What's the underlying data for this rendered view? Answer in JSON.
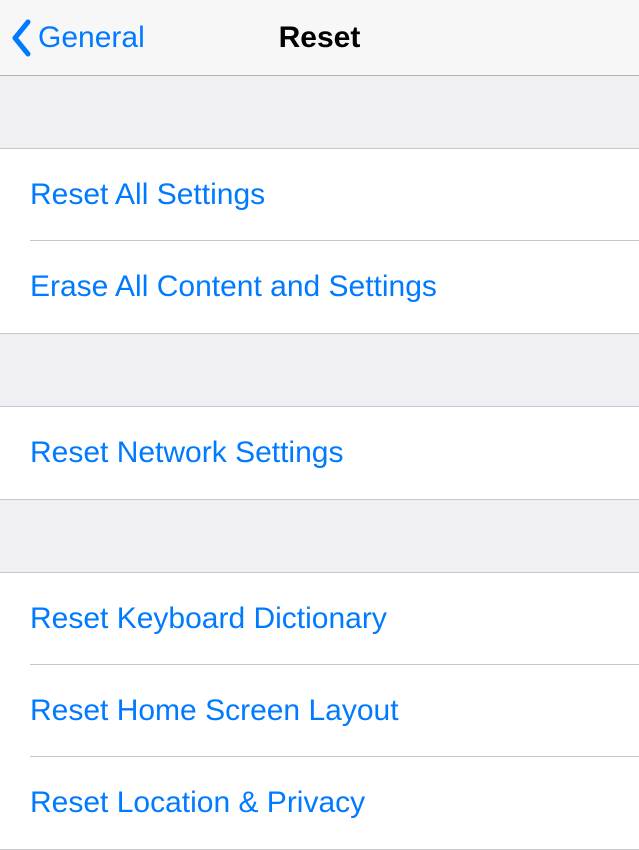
{
  "nav": {
    "back_label": "General",
    "title": "Reset"
  },
  "sections": [
    {
      "items": [
        {
          "label": "Reset All Settings"
        },
        {
          "label": "Erase All Content and Settings"
        }
      ]
    },
    {
      "items": [
        {
          "label": "Reset Network Settings"
        }
      ]
    },
    {
      "items": [
        {
          "label": "Reset Keyboard Dictionary"
        },
        {
          "label": "Reset Home Screen Layout"
        },
        {
          "label": "Reset Location & Privacy"
        }
      ]
    }
  ]
}
